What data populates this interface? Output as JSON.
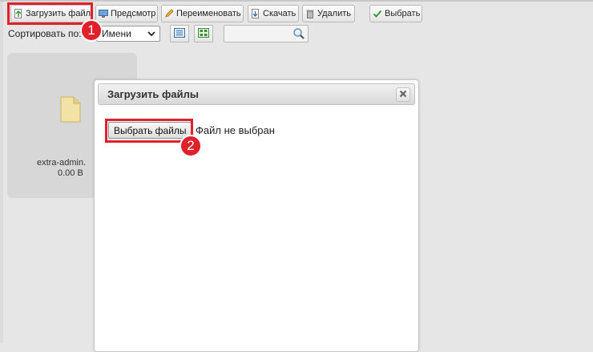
{
  "toolbar": {
    "upload_label": "Загрузить файл",
    "preview_label": "Предсмотр",
    "rename_label": "Переименовать",
    "download_label": "Скачать",
    "delete_label": "Удалить",
    "select_label": "Выбрать"
  },
  "sort": {
    "label": "Сортировать по:",
    "value": "Имени"
  },
  "file": {
    "name": "extra-admin.",
    "size": "0.00 B"
  },
  "dialog": {
    "title": "Загрузить файлы",
    "choose_label": "Выбрать файлы",
    "no_file_label": "Файл не выбран"
  },
  "annotations": {
    "badge1": "1",
    "badge2": "2",
    "color": "#e0202a"
  },
  "icons": [
    "upload-icon",
    "preview-icon",
    "rename-icon",
    "download-icon",
    "delete-icon",
    "select-icon",
    "list-view-icon",
    "grid-view-icon",
    "search-icon",
    "file-icon",
    "close-icon"
  ]
}
